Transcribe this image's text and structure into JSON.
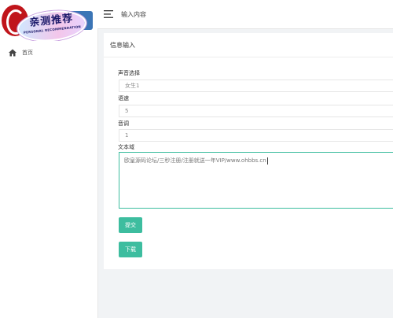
{
  "logo": {
    "badge_title": "亲测推荐",
    "badge_subtitle": "PERSONAL RECOMMENDATION"
  },
  "sidebar": {
    "items": [
      {
        "label": "首页",
        "icon": "home-icon"
      }
    ]
  },
  "topbar": {
    "title": "输入内容"
  },
  "card": {
    "title": "信息输入"
  },
  "form": {
    "voice": {
      "label": "声音选择",
      "value": "女生1"
    },
    "speed": {
      "label": "语速",
      "value": "5"
    },
    "pitch": {
      "label": "音调",
      "value": "1"
    },
    "text": {
      "label": "文本域",
      "value": "欧皇源码论坛/三秒注册/注册就送一年VIP/www.ohbbs.cn"
    }
  },
  "buttons": {
    "submit": "提交",
    "download": "下载"
  },
  "colors": {
    "accent": "#3dbd9f",
    "background": "#f1f3f5"
  }
}
